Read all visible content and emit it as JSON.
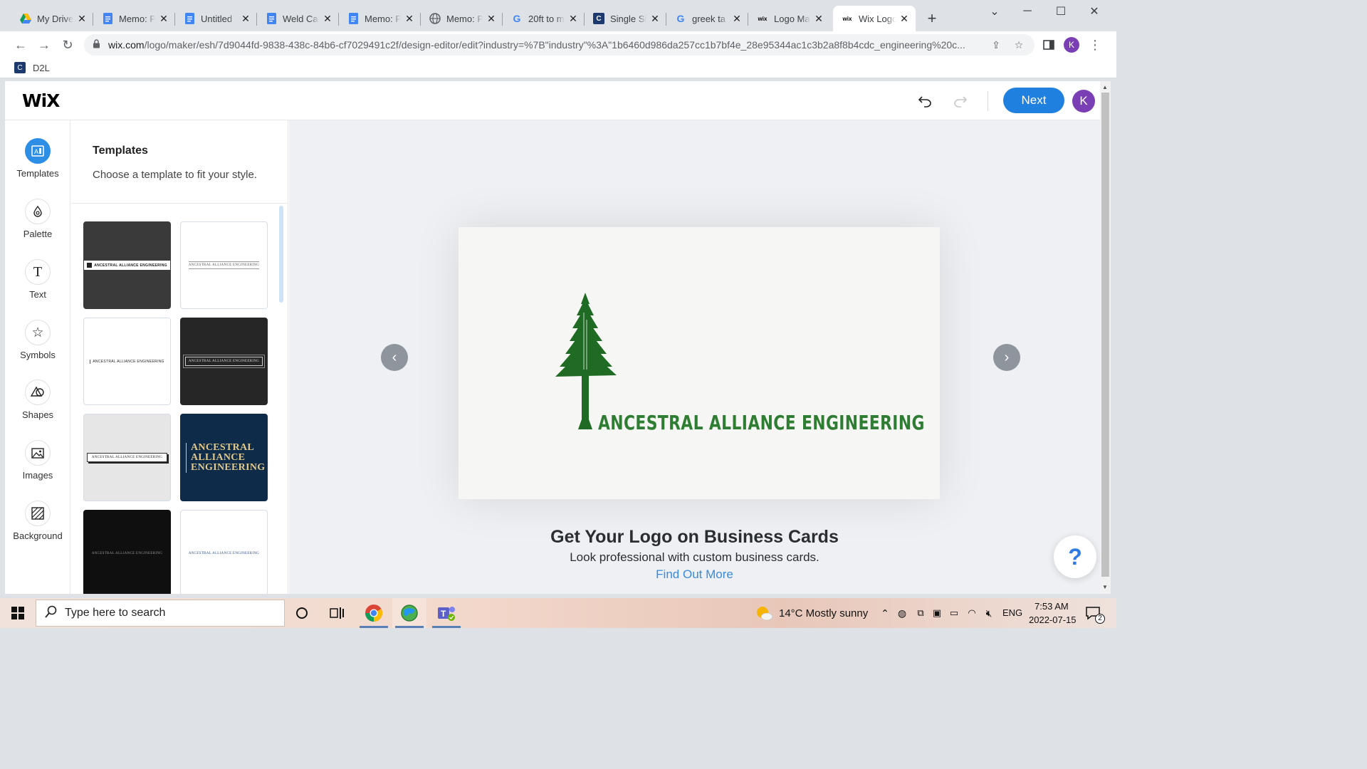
{
  "browser": {
    "tabs": [
      {
        "title": "My Drive",
        "icon": "google-drive-icon"
      },
      {
        "title": "Memo: P",
        "icon": "google-docs-icon"
      },
      {
        "title": "Untitled",
        "icon": "google-docs-icon"
      },
      {
        "title": "Weld Cal",
        "icon": "google-docs-icon"
      },
      {
        "title": "Memo: P",
        "icon": "google-docs-icon"
      },
      {
        "title": "Memo: P",
        "icon": "globe-icon"
      },
      {
        "title": "20ft to m",
        "icon": "google-icon"
      },
      {
        "title": "Single Si",
        "icon": "d2l-icon"
      },
      {
        "title": "greek ta",
        "icon": "google-icon"
      },
      {
        "title": "Logo Ma",
        "icon": "wix-icon"
      },
      {
        "title": "Wix Logo",
        "icon": "wix-icon",
        "active": true
      }
    ],
    "url_domain": "wix.com",
    "url_path": "/logo/maker/esh/7d9044fd-9838-438c-84b6-cf7029491c2f/design-editor/edit?industry=%7B\"industry\"%3A\"1b6460d986da257cc1b7bf4e_28e95344ac1c3b2a8f8b4cdc_engineering%20c...",
    "profile_initial": "K",
    "bookmark": "D2L"
  },
  "wix": {
    "logo": "WiX",
    "next_label": "Next",
    "user_initial": "K",
    "rail": [
      {
        "label": "Templates",
        "icon": "templates-icon",
        "active": true
      },
      {
        "label": "Palette",
        "icon": "palette-icon"
      },
      {
        "label": "Text",
        "icon": "text-icon"
      },
      {
        "label": "Symbols",
        "icon": "star-icon"
      },
      {
        "label": "Shapes",
        "icon": "shapes-icon"
      },
      {
        "label": "Images",
        "icon": "image-icon"
      },
      {
        "label": "Background",
        "icon": "background-icon"
      }
    ],
    "panel": {
      "title": "Templates",
      "subtitle": "Choose a template to fit your style."
    },
    "templates": [
      {
        "text": "ANCESTRAL ALLIANCE ENGINEERING",
        "bg": "#3a3a3a",
        "fg": "#222222"
      },
      {
        "text": "ANCESTRAL ALLIANCE ENGINEERING",
        "bg": "#ffffff",
        "fg": "#555555"
      },
      {
        "text": "ANCESTRAL ALLIANCE ENGINEERING",
        "bg": "#ffffff",
        "fg": "#222222"
      },
      {
        "text": "ANCESTRAL ALLIANCE ENGINEERING",
        "bg": "#262626",
        "fg": "#dddddd"
      },
      {
        "text": "ANCESTRAL ALLIANCE ENGINEERING",
        "bg": "#e6e6e6",
        "fg": "#222222"
      },
      {
        "text": "ANCESTRAL ALLIANCE ENGINEERING",
        "bg": "#0f2b4a",
        "fg": "#e2c98a"
      },
      {
        "text": "ANCESTRAL ALLIANCE ENGINEERING",
        "bg": "#0f0f0f",
        "fg": "#999999"
      },
      {
        "text": "ANCESTRAL ALLIANCE ENGINEERING",
        "bg": "#ffffff",
        "fg": "#2a4c8a"
      }
    ],
    "logo_text": "ANCESTRAL ALLIANCE ENGINEERING",
    "logo_color": "#2e7d32",
    "promo": {
      "title": "Get Your Logo on Business Cards",
      "subtitle": "Look professional with custom business cards.",
      "link": "Find Out More"
    },
    "help_label": "?"
  },
  "taskbar": {
    "search_placeholder": "Type here to search",
    "weather": "14°C  Mostly sunny",
    "language": "ENG",
    "time": "7:53 AM",
    "date": "2022-07-15",
    "notifications": "2"
  }
}
